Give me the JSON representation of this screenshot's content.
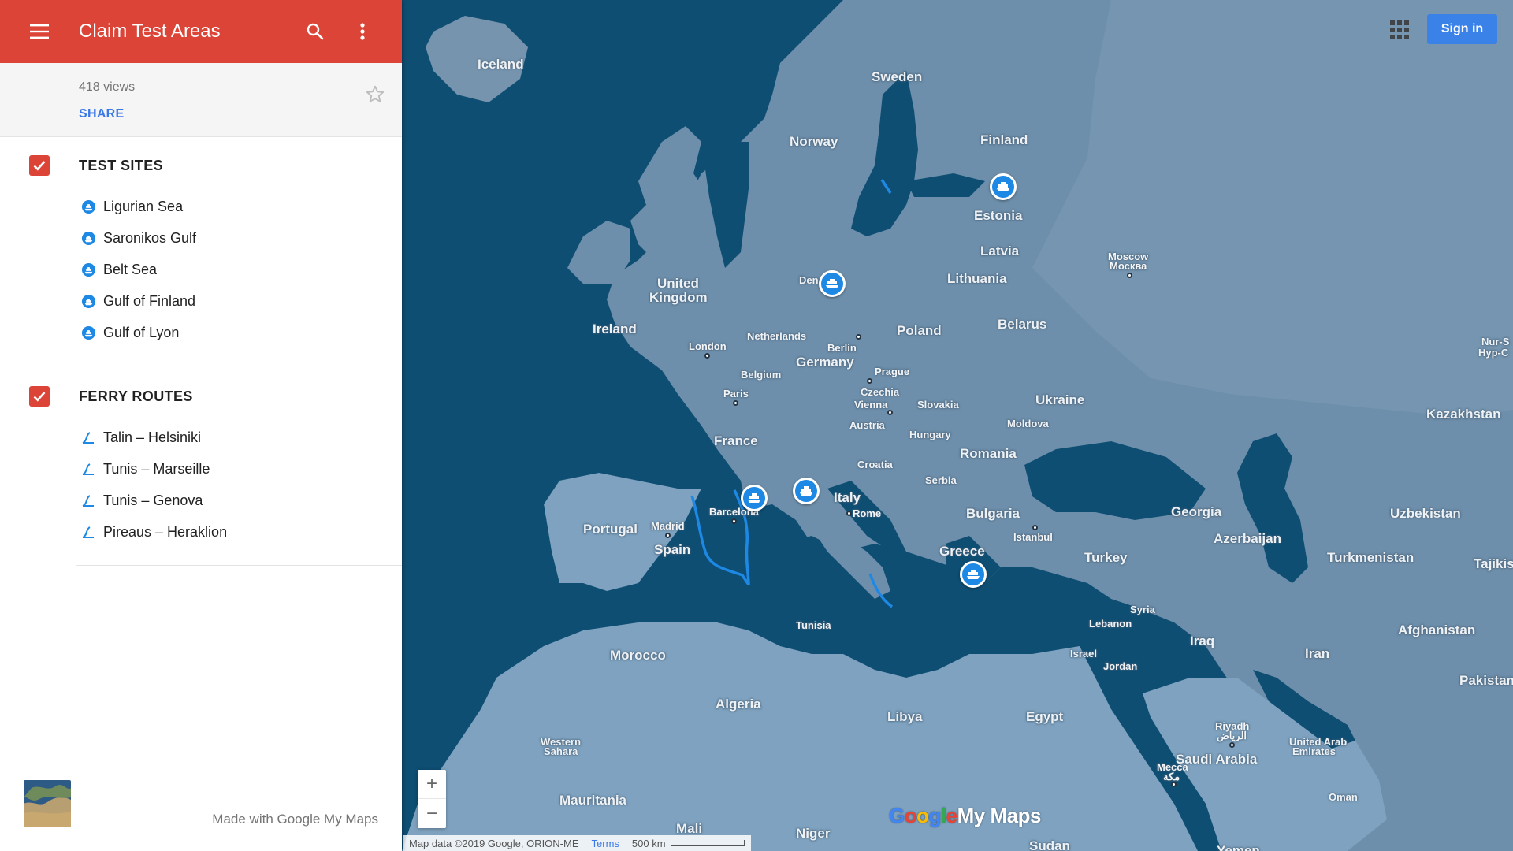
{
  "header": {
    "title": "Claim Test Areas"
  },
  "meta": {
    "views": "418 views",
    "share_label": "SHARE"
  },
  "layers": [
    {
      "title": "TEST SITES",
      "checked": true,
      "items": [
        {
          "label": "Ligurian Sea",
          "icon": "ferry-marker-icon"
        },
        {
          "label": "Saronikos Gulf",
          "icon": "ferry-marker-icon"
        },
        {
          "label": "Belt Sea",
          "icon": "ferry-marker-icon"
        },
        {
          "label": "Gulf of Finland",
          "icon": "ferry-marker-icon"
        },
        {
          "label": "Gulf of Lyon",
          "icon": "ferry-marker-icon"
        }
      ]
    },
    {
      "title": "FERRY ROUTES",
      "checked": true,
      "items": [
        {
          "label": "Talin – Helsiniki",
          "icon": "route-line-icon"
        },
        {
          "label": "Tunis – Marseille",
          "icon": "route-line-icon"
        },
        {
          "label": "Tunis – Genova",
          "icon": "route-line-icon"
        },
        {
          "label": "Pireaus – Heraklion",
          "icon": "route-line-icon"
        }
      ]
    }
  ],
  "footer": {
    "made_with": "Made with Google My Maps"
  },
  "map": {
    "signin_label": "Sign in",
    "zoom_in": "+",
    "zoom_out": "−",
    "attribution": "Map data ©2019 Google, ORION-ME",
    "terms": "Terms",
    "scale": "500 km",
    "brand": {
      "g": "G",
      "o1": "o",
      "o2": "o",
      "g2": "g",
      "l": "l",
      "e": "e",
      "rest": "My Maps"
    },
    "countries": [
      "Iceland",
      "Sweden",
      "Norway",
      "Finland",
      "Estonia",
      "Latvia",
      "Lithuania",
      "United",
      "Kingdom",
      "Ireland",
      "Poland",
      "Belarus",
      "Netherlands",
      "Belgium",
      "Germany",
      "Czechia",
      "Slovakia",
      "Austria",
      "Hungary",
      "Ukraine",
      "Moldova",
      "Romania",
      "France",
      "Croatia",
      "Serbia",
      "Italy",
      "Bulgaria",
      "Portugal",
      "Spain",
      "Greece",
      "Turkey",
      "Georgia",
      "Azerbaijan",
      "Kazakhstan",
      "Uzbekistan",
      "Turkmenistan",
      "Tajikis",
      "Syria",
      "Lebanon",
      "Iraq",
      "Iran",
      "Israel",
      "Jordan",
      "Afghanistan",
      "Pakistan",
      "Morocco",
      "Algeria",
      "Tunisia",
      "Libya",
      "Egypt",
      "Western",
      "Sahara",
      "Mauritania",
      "Mali",
      "Niger",
      "Sudan",
      "Saudi Arabia",
      "United Arab",
      "Emirates",
      "Oman",
      "Den",
      "Yemen",
      "Nur-S",
      "Hyp-C"
    ],
    "cities": [
      "London",
      "Paris",
      "Berlin",
      "Prague",
      "Vienna",
      "Madrid",
      "Barcelona",
      "Rome",
      "Istanbul",
      "Moscow",
      "Москва",
      "Riyadh",
      "الرياض",
      "Mecca",
      "مكة"
    ],
    "colors": {
      "water": "#0e4e73",
      "land": "#6e8fab",
      "land_light": "#7ea2bf",
      "route": "#1e88e5",
      "marker": "#1e88e5"
    }
  }
}
